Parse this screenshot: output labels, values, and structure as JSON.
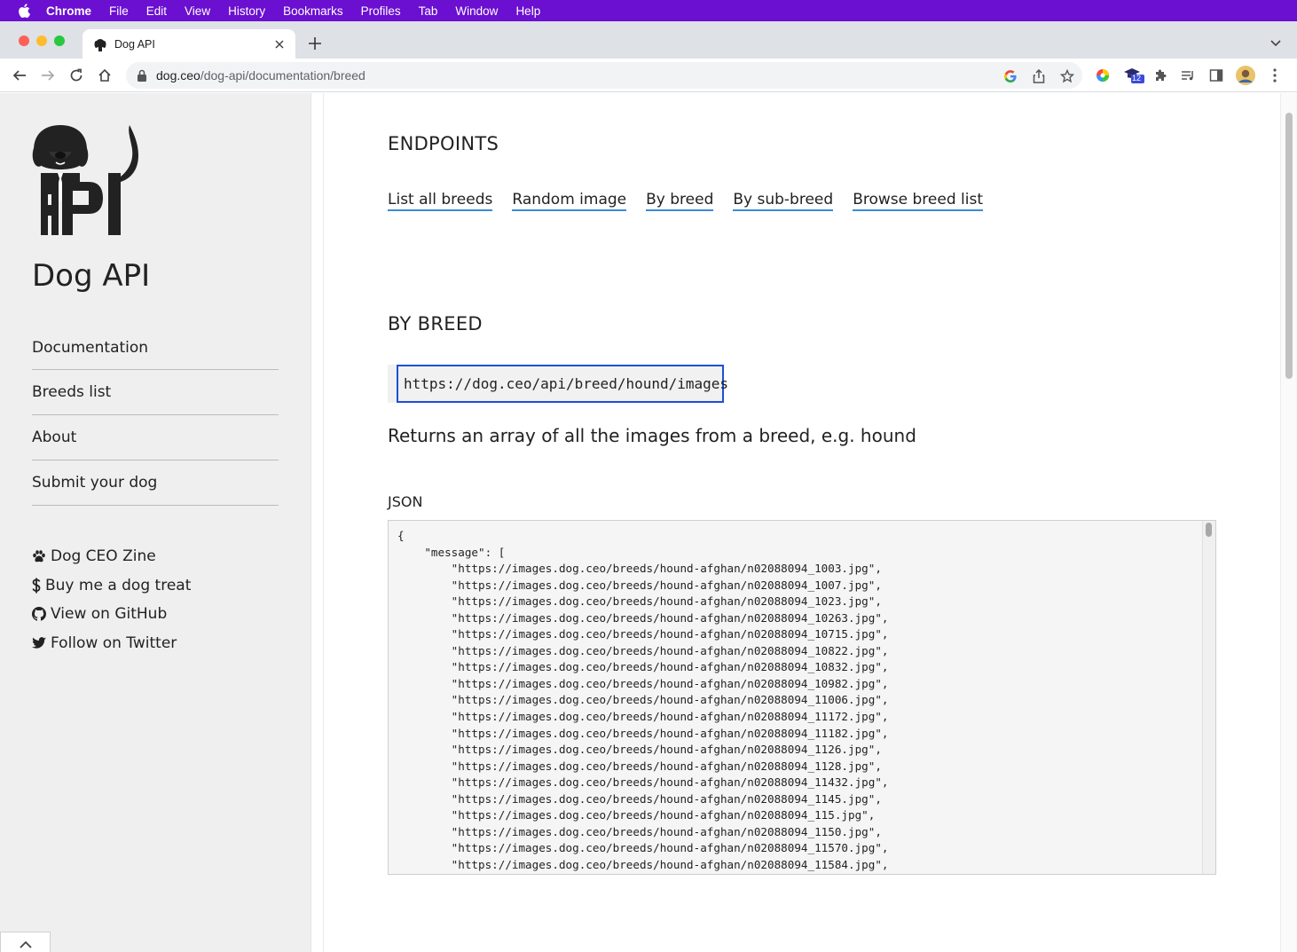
{
  "menubar": {
    "app": "Chrome",
    "items": [
      "File",
      "Edit",
      "View",
      "History",
      "Bookmarks",
      "Profiles",
      "Tab",
      "Window",
      "Help"
    ]
  },
  "browser": {
    "tab_title": "Dog API",
    "url_host": "dog.ceo",
    "url_path": "/dog-api/documentation/breed",
    "extension_badge": "12"
  },
  "sidebar": {
    "site_title": "Dog API",
    "nav": [
      "Documentation",
      "Breeds list",
      "About",
      "Submit your dog"
    ],
    "links": [
      {
        "icon": "paw-icon",
        "label": "Dog CEO Zine"
      },
      {
        "icon": "dollar-icon",
        "label": "Buy me a dog treat"
      },
      {
        "icon": "github-icon",
        "label": "View on GitHub"
      },
      {
        "icon": "twitter-icon",
        "label": "Follow on Twitter"
      }
    ]
  },
  "main": {
    "endpoints_heading": "ENDPOINTS",
    "endpoint_links": [
      "List all breeds",
      "Random image",
      "By breed",
      "By sub-breed",
      "Browse breed list"
    ],
    "section_heading": "BY BREED",
    "endpoint_url": "https://dog.ceo/api/breed/hound/images",
    "description": "Returns an array of all the images from a breed, e.g. hound",
    "json_label": "JSON",
    "json_lines": [
      "{",
      "    \"message\": [",
      "        \"https://images.dog.ceo/breeds/hound-afghan/n02088094_1003.jpg\",",
      "        \"https://images.dog.ceo/breeds/hound-afghan/n02088094_1007.jpg\",",
      "        \"https://images.dog.ceo/breeds/hound-afghan/n02088094_1023.jpg\",",
      "        \"https://images.dog.ceo/breeds/hound-afghan/n02088094_10263.jpg\",",
      "        \"https://images.dog.ceo/breeds/hound-afghan/n02088094_10715.jpg\",",
      "        \"https://images.dog.ceo/breeds/hound-afghan/n02088094_10822.jpg\",",
      "        \"https://images.dog.ceo/breeds/hound-afghan/n02088094_10832.jpg\",",
      "        \"https://images.dog.ceo/breeds/hound-afghan/n02088094_10982.jpg\",",
      "        \"https://images.dog.ceo/breeds/hound-afghan/n02088094_11006.jpg\",",
      "        \"https://images.dog.ceo/breeds/hound-afghan/n02088094_11172.jpg\",",
      "        \"https://images.dog.ceo/breeds/hound-afghan/n02088094_11182.jpg\",",
      "        \"https://images.dog.ceo/breeds/hound-afghan/n02088094_1126.jpg\",",
      "        \"https://images.dog.ceo/breeds/hound-afghan/n02088094_1128.jpg\",",
      "        \"https://images.dog.ceo/breeds/hound-afghan/n02088094_11432.jpg\",",
      "        \"https://images.dog.ceo/breeds/hound-afghan/n02088094_1145.jpg\",",
      "        \"https://images.dog.ceo/breeds/hound-afghan/n02088094_115.jpg\",",
      "        \"https://images.dog.ceo/breeds/hound-afghan/n02088094_1150.jpg\",",
      "        \"https://images.dog.ceo/breeds/hound-afghan/n02088094_11570.jpg\",",
      "        \"https://images.dog.ceo/breeds/hound-afghan/n02088094_11584.jpg\","
    ]
  },
  "colors": {
    "menubar": "#6b0fd0",
    "link_underline": "#3a8bd8",
    "focus_border": "#1d4fd8",
    "sidebar_bg": "#efefef"
  }
}
